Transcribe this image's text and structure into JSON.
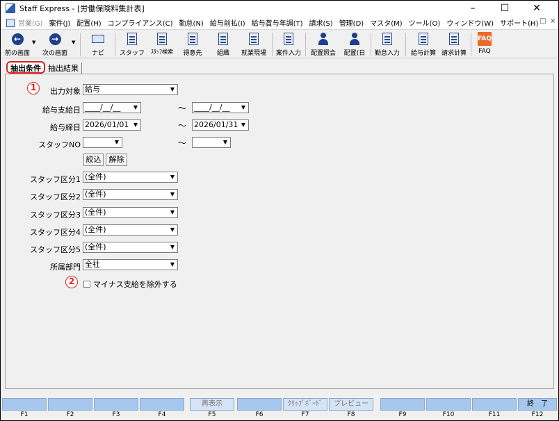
{
  "window": {
    "title": "Staff Express - [労働保険料集計表]",
    "controls": [
      "–",
      "☐",
      "✕"
    ]
  },
  "menubar": {
    "items": [
      {
        "label": "営業(G)",
        "disabled": true
      },
      {
        "label": "案件(J)"
      },
      {
        "label": "配置(H)"
      },
      {
        "label": "コンプライアンス(C)"
      },
      {
        "label": "勤怠(N)"
      },
      {
        "label": "給与前払(I)"
      },
      {
        "label": "給与賞与年調(T)"
      },
      {
        "label": "請求(S)"
      },
      {
        "label": "管理(D)"
      },
      {
        "label": "マスタ(M)"
      },
      {
        "label": "ツール(O)"
      },
      {
        "label": "ウィンドウ(W)"
      },
      {
        "label": "サポート(H)"
      }
    ],
    "mdi_controls": [
      "_",
      "□",
      "×"
    ]
  },
  "toolbar": {
    "items": [
      {
        "label": "前の画面",
        "icon": "arrow-left-icon"
      },
      {
        "label": "次の画面",
        "icon": "arrow-right-icon"
      },
      {
        "label": "ナビ",
        "icon": "keyboard-icon"
      },
      {
        "label": "スタッフ",
        "icon": "staff-icon"
      },
      {
        "label": "ｽﾀｯﾌ検索",
        "icon": "staff-search-icon"
      },
      {
        "label": "得意先",
        "icon": "client-icon"
      },
      {
        "label": "組織",
        "icon": "organization-icon"
      },
      {
        "label": "就業現場",
        "icon": "workplace-icon"
      },
      {
        "label": "案件入力",
        "icon": "case-entry-icon"
      },
      {
        "label": "配置照会",
        "icon": "placement-inquiry-icon"
      },
      {
        "label": "配置(日",
        "icon": "placement-daily-icon"
      },
      {
        "label": "勤怠入力",
        "icon": "attendance-entry-icon"
      },
      {
        "label": "給与計算",
        "icon": "payroll-calc-icon"
      },
      {
        "label": "請求計算",
        "icon": "billing-calc-icon"
      },
      {
        "label": "FAQ",
        "icon": "faq-icon"
      }
    ]
  },
  "tabs": [
    {
      "label": "抽出条件",
      "active": true
    },
    {
      "label": "抽出結果",
      "active": false
    }
  ],
  "form": {
    "output_target": {
      "badge": "1",
      "label": "出力対象",
      "value": "給与"
    },
    "pay_date": {
      "label": "給与支給日",
      "from": "____/__/__",
      "to": "____/__/__",
      "sep": "～"
    },
    "pay_close": {
      "label": "給与締日",
      "from": "2026/01/01",
      "to": "2026/01/31",
      "sep": "～"
    },
    "staff_no": {
      "label": "スタッフNO",
      "from": "",
      "to": "",
      "sep": "～"
    },
    "filter_btn": "絞込",
    "clear_btn": "解除",
    "staff_categories": [
      {
        "label": "スタッフ区分1",
        "value": "(全件)"
      },
      {
        "label": "スタッフ区分2",
        "value": "(全件)"
      },
      {
        "label": "スタッフ区分3",
        "value": "(全件)"
      },
      {
        "label": "スタッフ区分4",
        "value": "(全件)"
      },
      {
        "label": "スタッフ区分5",
        "value": "(全件)"
      }
    ],
    "department": {
      "label": "所属部門",
      "value": "全社"
    },
    "exclude_negative": {
      "badge": "2",
      "label": "マイナス支給を除外する",
      "checked": false
    }
  },
  "fkeys": [
    {
      "key": "F1",
      "label": ""
    },
    {
      "key": "F2",
      "label": ""
    },
    {
      "key": "F3",
      "label": ""
    },
    {
      "key": "F4",
      "label": ""
    },
    {
      "key": "F5",
      "label": "再表示"
    },
    {
      "key": "F6",
      "label": ""
    },
    {
      "key": "F7",
      "label": "ｸﾘｯﾌﾟﾎﾞｰﾄﾞ"
    },
    {
      "key": "F8",
      "label": "プレビュー"
    },
    {
      "key": "F9",
      "label": ""
    },
    {
      "key": "F10",
      "label": ""
    },
    {
      "key": "F11",
      "label": ""
    },
    {
      "key": "F12",
      "label": "終　了"
    }
  ]
}
